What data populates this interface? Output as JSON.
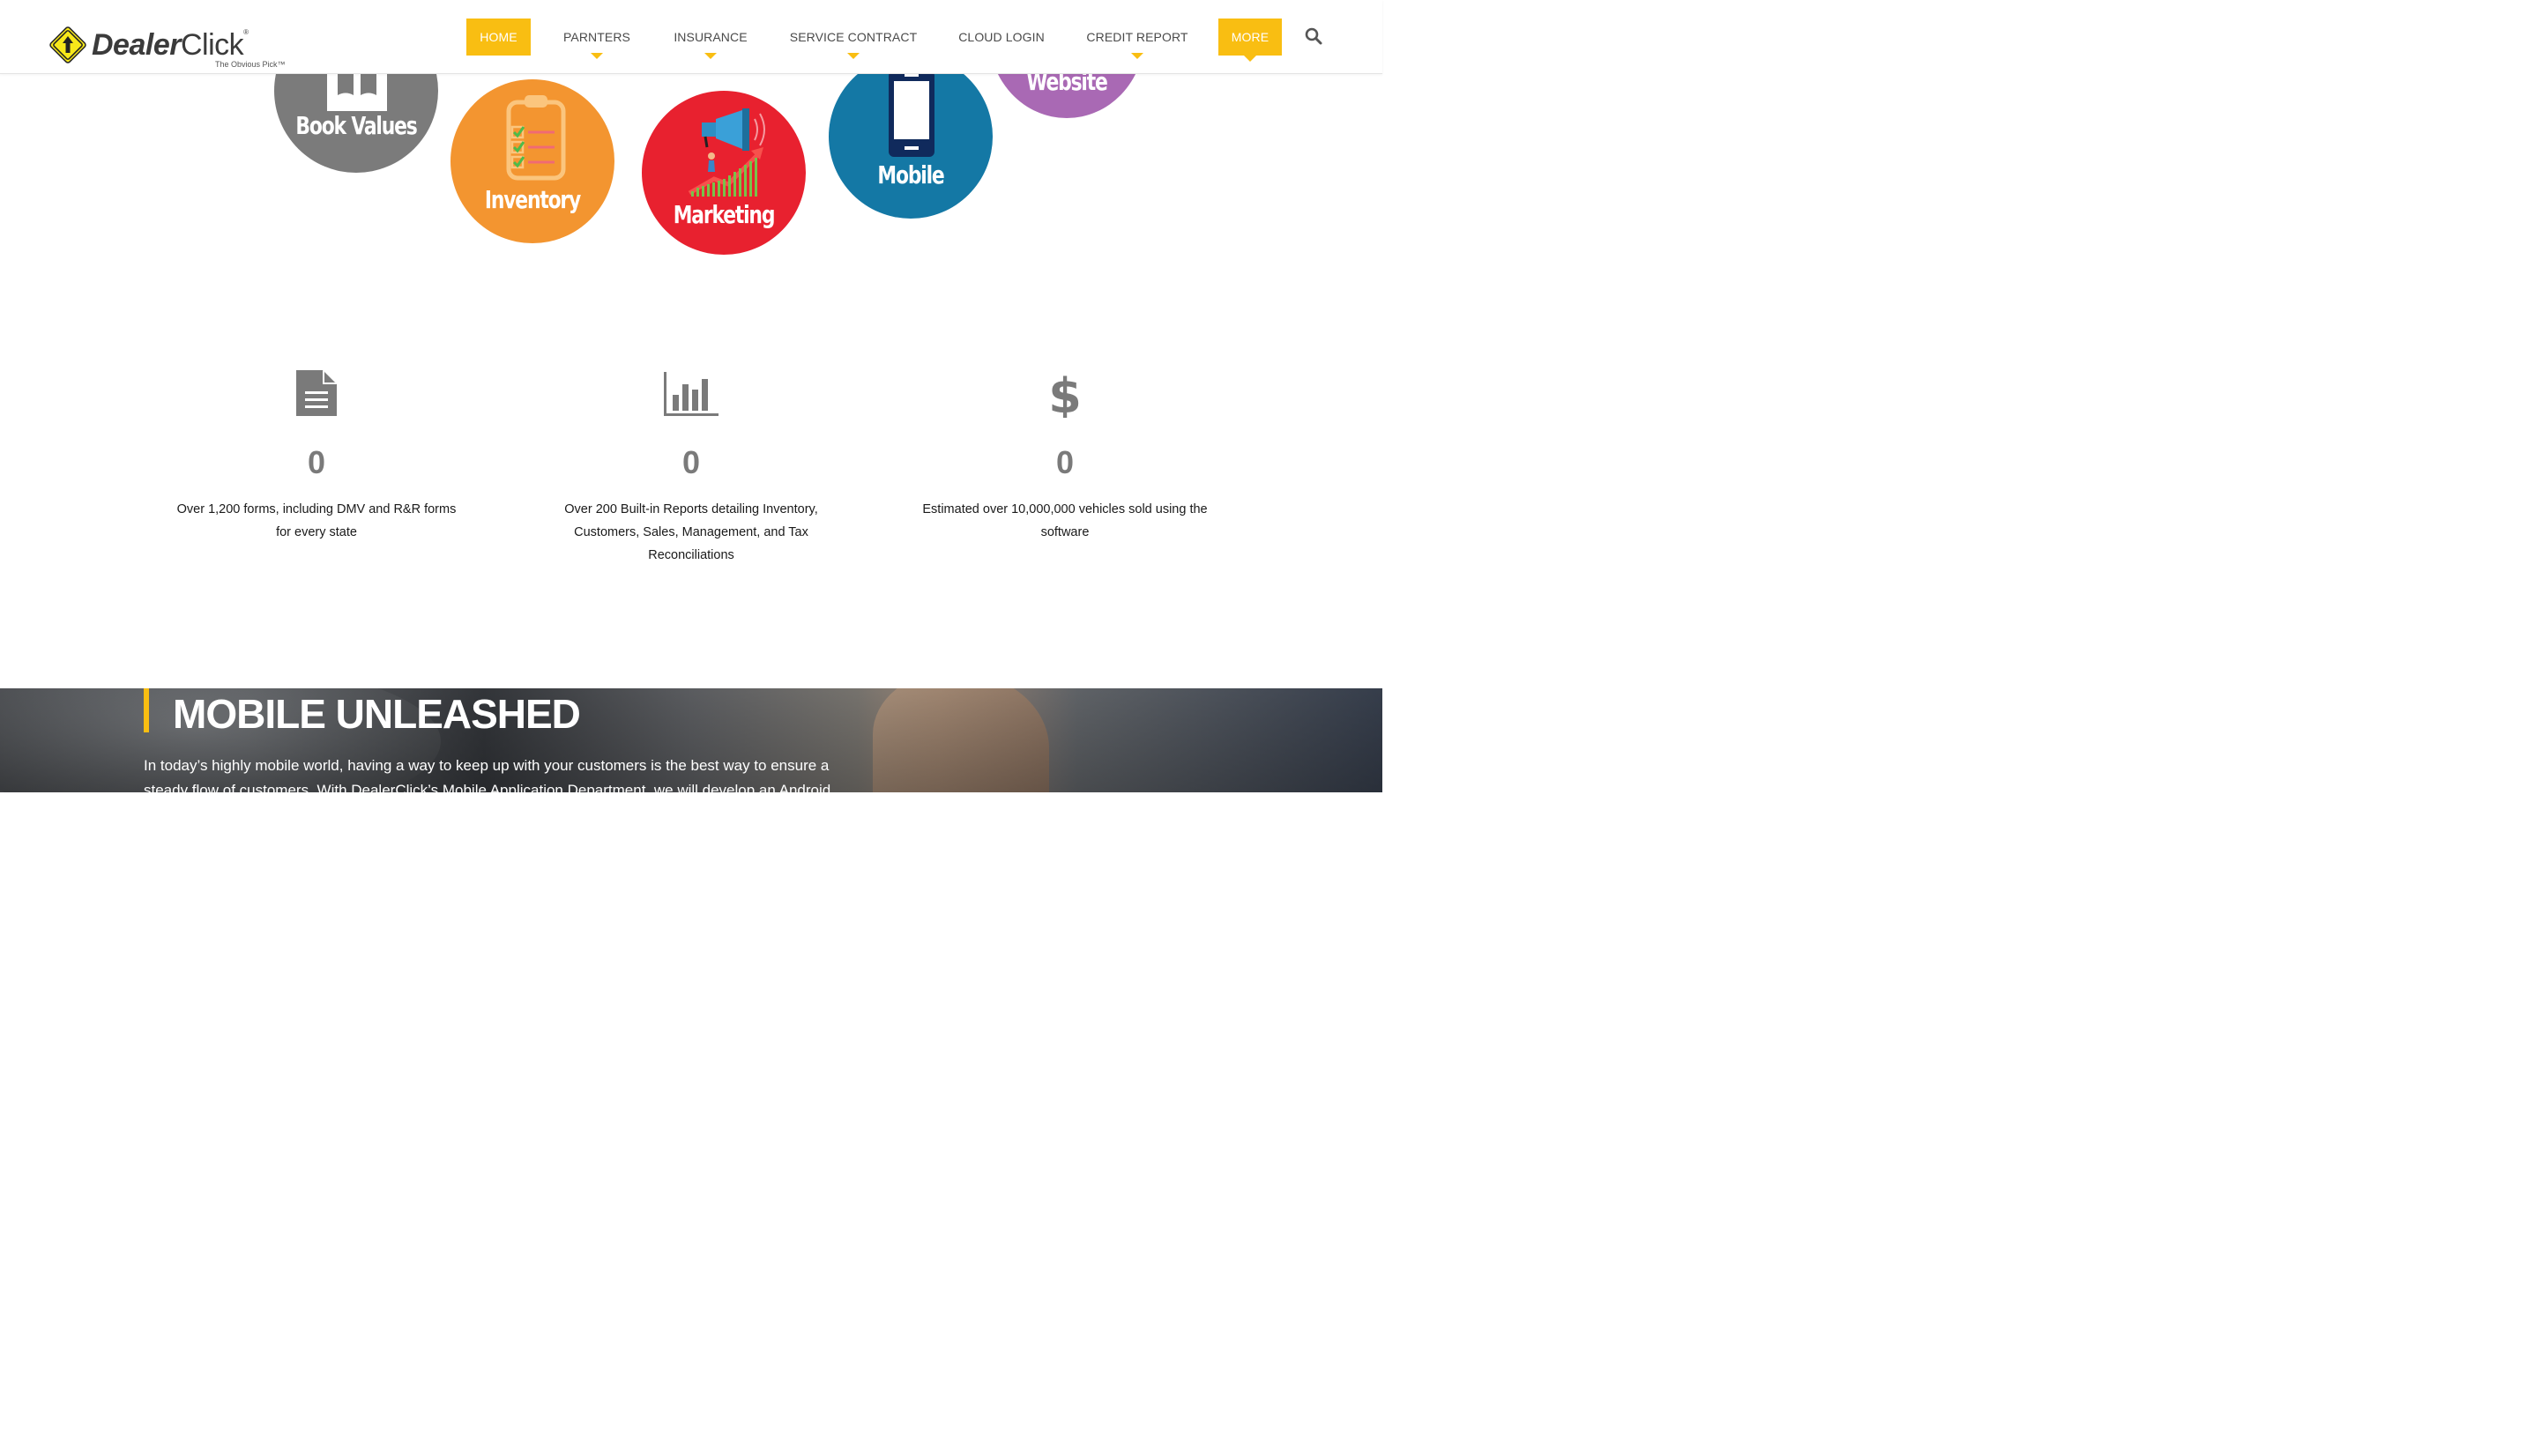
{
  "brand": {
    "name_bold": "Dealer",
    "name_light": "Click",
    "registered": "®",
    "tagline": "The Obvious Pick™",
    "accent_color": "#f9be12"
  },
  "nav": {
    "items": [
      {
        "label": "HOME",
        "active": true,
        "has_dropdown": false
      },
      {
        "label": "PARNTERS",
        "active": false,
        "has_dropdown": true
      },
      {
        "label": "INSURANCE",
        "active": false,
        "has_dropdown": true
      },
      {
        "label": "SERVICE CONTRACT",
        "active": false,
        "has_dropdown": true
      },
      {
        "label": "CLOUD LOGIN",
        "active": false,
        "has_dropdown": false
      },
      {
        "label": "CREDIT REPORT",
        "active": false,
        "has_dropdown": true
      },
      {
        "label": "MORE",
        "active": true,
        "has_dropdown": true
      }
    ],
    "search_icon": "search-icon"
  },
  "features": [
    {
      "label": "Book Values",
      "color": "#7b7b7b",
      "icon": "book-icon"
    },
    {
      "label": "Inventory",
      "color": "#f39530",
      "icon": "clipboard-icon"
    },
    {
      "label": "Marketing",
      "color": "#e8212f",
      "icon": "megaphone-icon"
    },
    {
      "label": "Mobile",
      "color": "#1478a5",
      "icon": "smartphone-icon"
    },
    {
      "label": "Website",
      "color": "#a969b4",
      "icon": "website-icon"
    }
  ],
  "stats": [
    {
      "icon": "document-icon",
      "value": "0",
      "text": "Over 1,200 forms, including DMV and R&R forms for every state"
    },
    {
      "icon": "bar-chart-icon",
      "value": "0",
      "text": "Over 200 Built-in Reports detailing Inventory, Customers, Sales, Management, and Tax Reconciliations"
    },
    {
      "icon": "dollar-icon",
      "value": "0",
      "text": "Estimated over 10,000,000 vehicles sold using the software"
    }
  ],
  "mobile_section": {
    "title": "MOBILE UNLEASHED",
    "body": "In today’s highly mobile world, having a way to keep up with your customers is the best way to ensure a steady flow of customers. With DealerClick’s Mobile Application Department, we will develop an Android"
  }
}
